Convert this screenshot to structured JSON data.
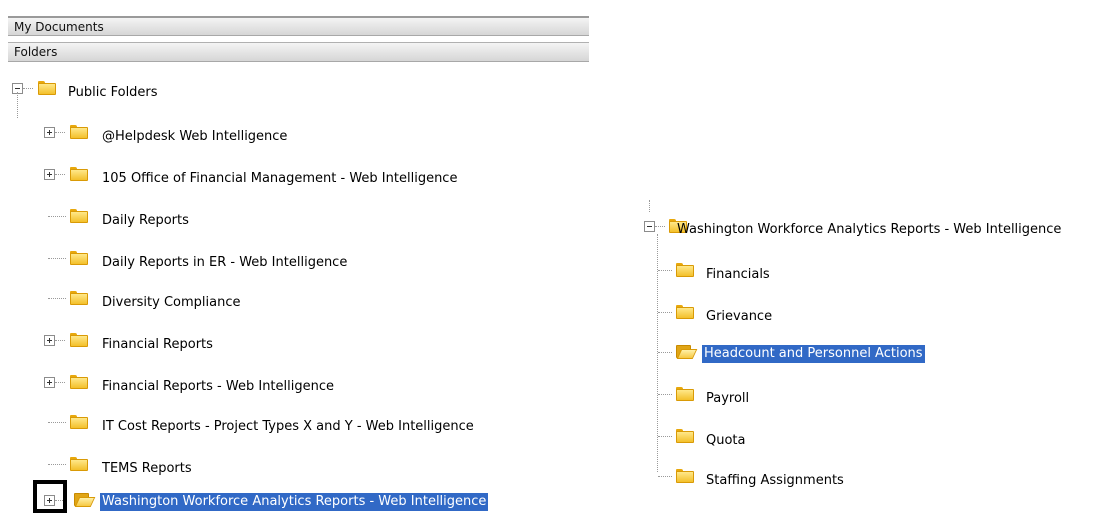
{
  "headers": {
    "my_documents": "My Documents",
    "folders": "Folders"
  },
  "left_tree": {
    "root": "Public Folders",
    "items": [
      {
        "label": "@Helpdesk Web Intelligence",
        "expander": "plus"
      },
      {
        "label": "105 Office of Financial Management - Web Intelligence",
        "expander": "plus"
      },
      {
        "label": "Daily Reports",
        "expander": "none"
      },
      {
        "label": "Daily Reports in ER - Web Intelligence",
        "expander": "none"
      },
      {
        "label": "Diversity Compliance",
        "expander": "none"
      },
      {
        "label": "Financial Reports",
        "expander": "plus"
      },
      {
        "label": "Financial Reports - Web Intelligence",
        "expander": "plus"
      },
      {
        "label": "IT Cost Reports - Project Types X and Y - Web Intelligence",
        "expander": "none"
      },
      {
        "label": "TEMS Reports",
        "expander": "none"
      },
      {
        "label": "Washington Workforce Analytics Reports - Web Intelligence",
        "expander": "plus",
        "selected": true
      }
    ]
  },
  "right_tree": {
    "root": "Washington Workforce Analytics Reports - Web Intelligence",
    "items": [
      {
        "label": "Financials"
      },
      {
        "label": "Grievance"
      },
      {
        "label": "Headcount and Personnel Actions",
        "selected": true
      },
      {
        "label": "Payroll"
      },
      {
        "label": "Quota"
      },
      {
        "label": "Staffing Assignments"
      }
    ]
  },
  "colors": {
    "selection": "#3169c6",
    "header_bg": "#e0e0e0",
    "folder": "#f3c02b"
  }
}
